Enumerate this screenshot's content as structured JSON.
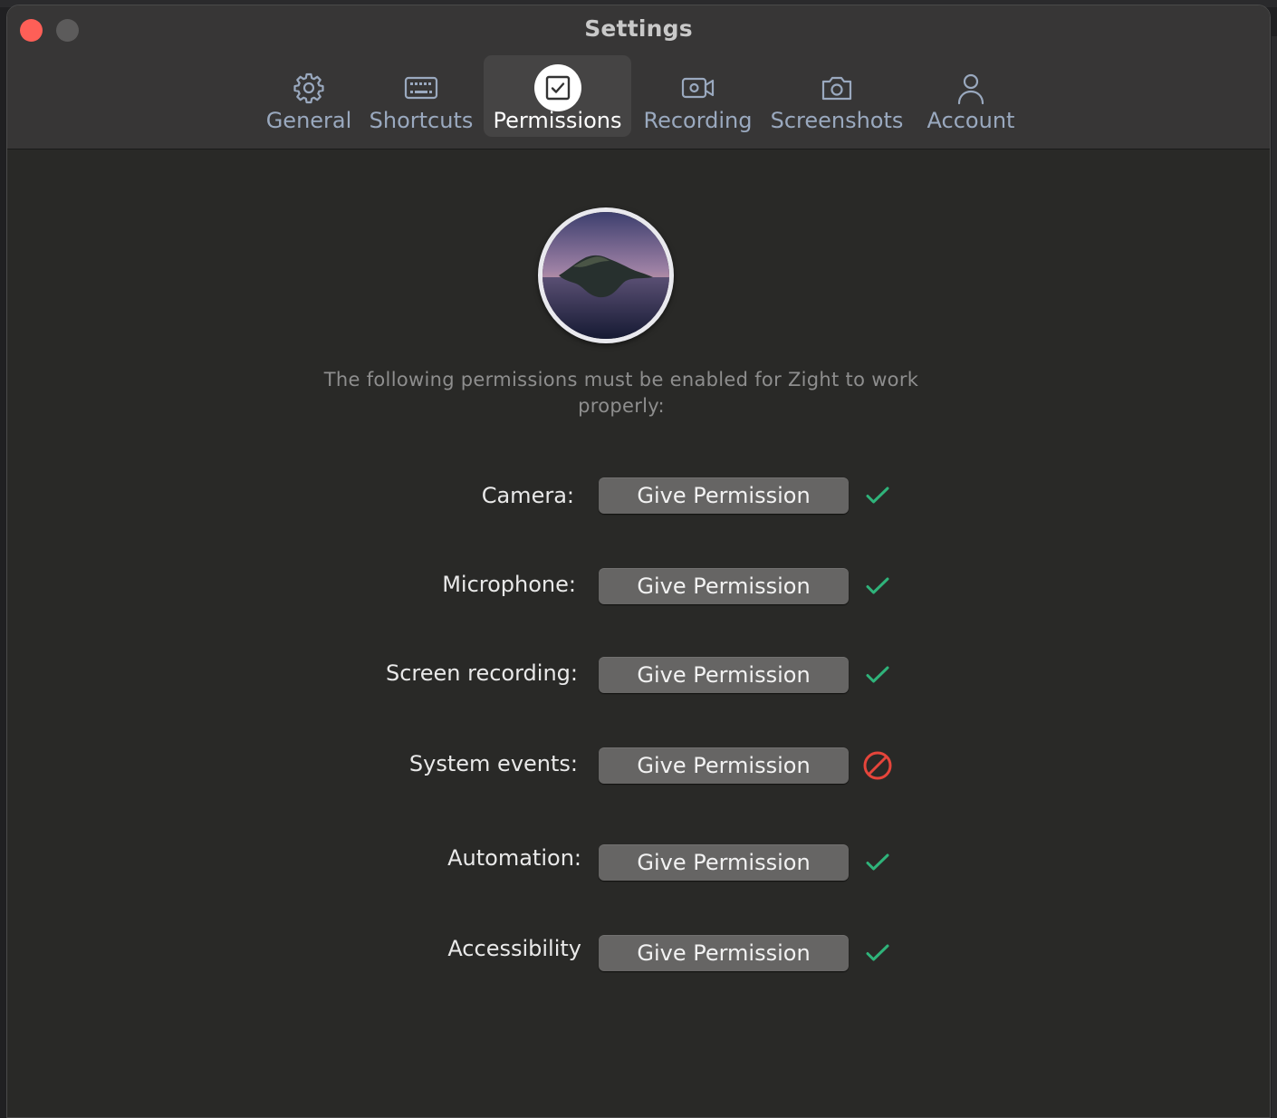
{
  "window": {
    "title": "Settings"
  },
  "tabs": [
    {
      "label": "General",
      "icon": "gear-icon",
      "active": false
    },
    {
      "label": "Shortcuts",
      "icon": "keyboard-icon",
      "active": false
    },
    {
      "label": "Permissions",
      "icon": "checkbox-icon",
      "active": true
    },
    {
      "label": "Recording",
      "icon": "video-camera-icon",
      "active": false
    },
    {
      "label": "Screenshots",
      "icon": "camera-icon",
      "active": false
    },
    {
      "label": "Account",
      "icon": "person-icon",
      "active": false
    }
  ],
  "permissions": {
    "intro": "The following permissions must be enabled for Zight to work properly:",
    "button_label": "Give Permission",
    "items": [
      {
        "label": "Camera:",
        "status": "granted"
      },
      {
        "label": "Microphone:",
        "status": "granted"
      },
      {
        "label": "Screen recording:",
        "status": "granted"
      },
      {
        "label": "System events:",
        "status": "denied"
      },
      {
        "label": "Automation:",
        "status": "granted"
      },
      {
        "label": "Accessibility",
        "status": "granted"
      }
    ]
  },
  "colors": {
    "granted": "#2fb37a",
    "denied": "#e5453b",
    "tab_inactive": "#9aa9bf",
    "close_button": "#fe5f57"
  }
}
